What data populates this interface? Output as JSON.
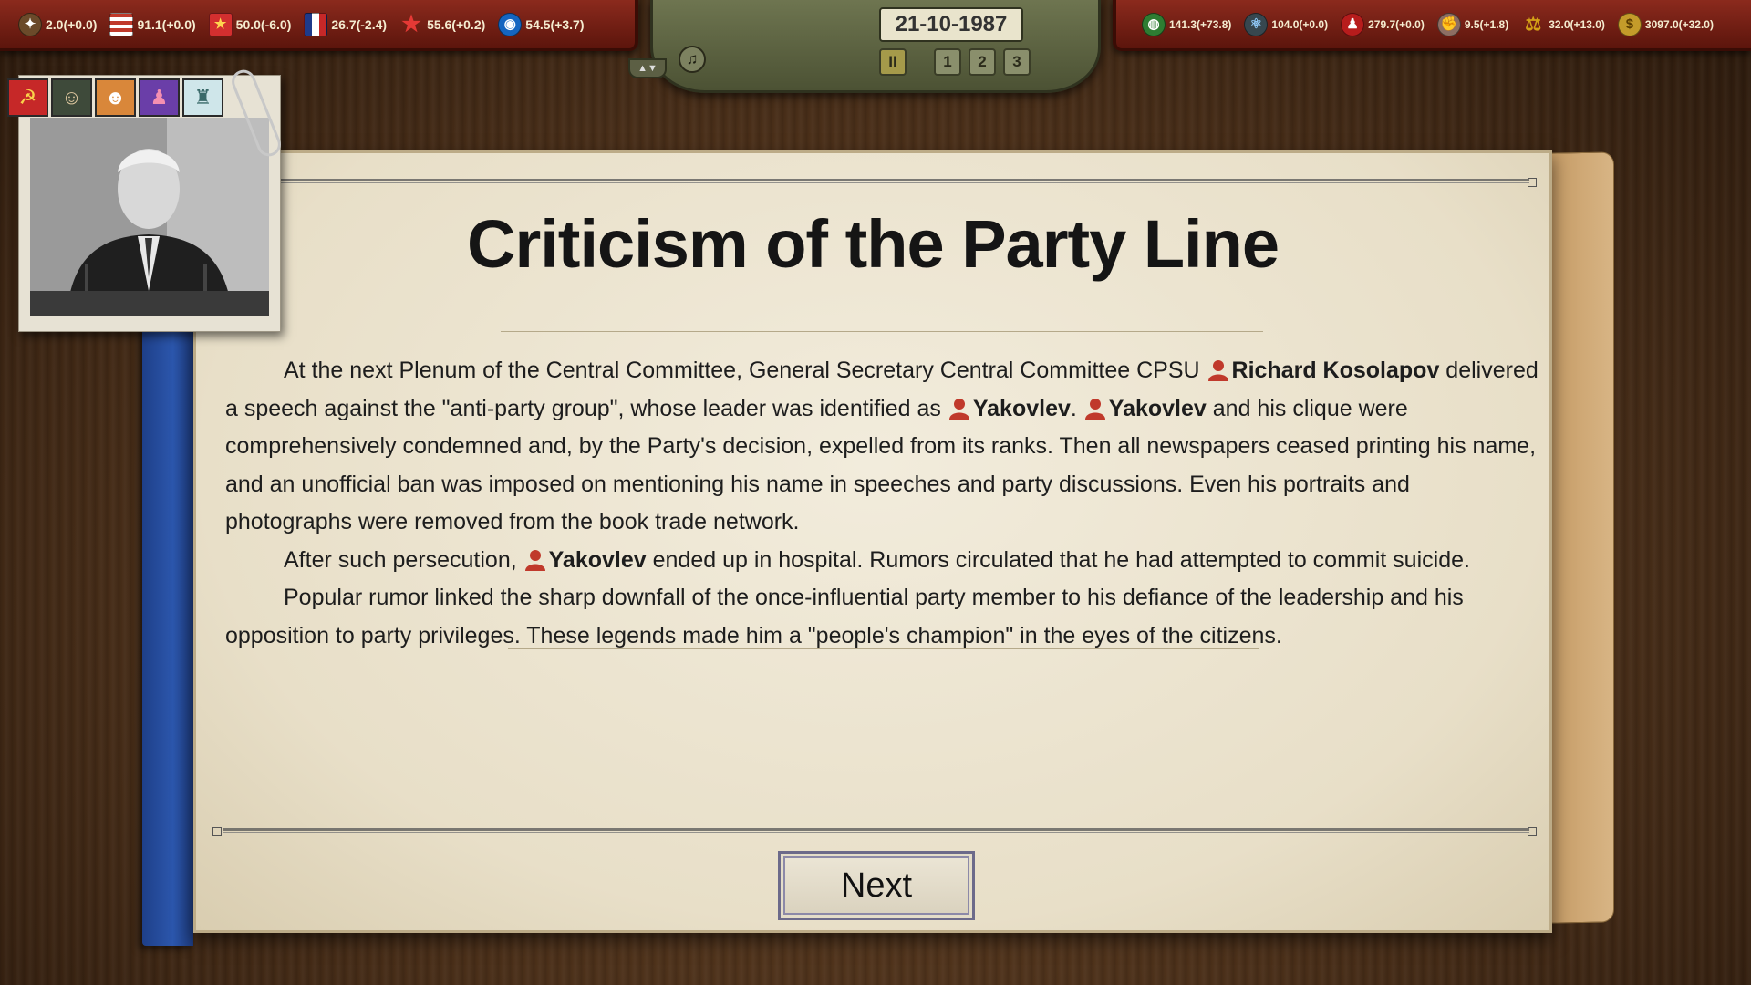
{
  "top_left_stats": [
    {
      "icon": "eagle-icon",
      "value": "2.0(+0.0)"
    },
    {
      "icon": "usa-flag-icon",
      "value": "91.1(+0.0)"
    },
    {
      "icon": "china-flag-icon",
      "value": "50.0(-6.0)"
    },
    {
      "icon": "france-flag-icon",
      "value": "26.7(-2.4)"
    },
    {
      "icon": "red-star-icon",
      "value": "55.6(+0.2)"
    },
    {
      "icon": "globe-badge-icon",
      "value": "54.5(+3.7)"
    }
  ],
  "top_right_stats": [
    {
      "icon": "world-icon",
      "value": "141.3(+73.8)"
    },
    {
      "icon": "atom-icon",
      "value": "104.0(+0.0)"
    },
    {
      "icon": "people-icon",
      "value": "279.7(+0.0)"
    },
    {
      "icon": "fist-icon",
      "value": "9.5(+1.8)"
    },
    {
      "icon": "scales-icon",
      "value": "32.0(+13.0)"
    },
    {
      "icon": "coins-icon",
      "value": "3097.0(+32.0)"
    }
  ],
  "date": "21-10-1987",
  "speed_buttons": [
    "1",
    "2",
    "3"
  ],
  "pause_symbol": "II",
  "music_symbol": "♫",
  "arrow_symbol": "▲▼",
  "trait_icons": [
    {
      "name": "red-stamp-icon",
      "glyph": "☭",
      "bg": "#c62828"
    },
    {
      "name": "bearded-man-icon",
      "glyph": "☺",
      "bg": "#3e4a3a"
    },
    {
      "name": "worker-cap-icon",
      "glyph": "☻",
      "bg": "#d9873a"
    },
    {
      "name": "pink-figure-icon",
      "glyph": "♟",
      "bg": "#6a3ea8"
    },
    {
      "name": "factory-icon",
      "glyph": "♜",
      "bg": "#cfe6ea"
    }
  ],
  "event": {
    "title": "Criticism of the Party Line",
    "p1": {
      "t1": "At the next Plenum of the Central Committee, General Secretary Central Committee CPSU ",
      "n1": "Richard Kosolapov",
      "t2": " delivered a speech against the \"anti-party group\", whose leader was identified as ",
      "n2": "Yakovlev",
      "t3": ". ",
      "n3": "Yakovlev",
      "t4": " and his clique were comprehensively condemned and, by the Party's decision, expelled from its ranks. Then all newspapers ceased printing his name, and an unofficial ban was imposed on mentioning his name in speeches and party discussions. Even his portraits and photographs were removed from the book trade network."
    },
    "p2": {
      "t1": "After such persecution, ",
      "n1": "Yakovlev",
      "t2": " ended up in hospital. Rumors circulated that he had attempted to commit suicide."
    },
    "p3": "Popular rumor linked the sharp downfall of the once-influential party member to his defiance of the leadership and his opposition to party privileges. These legends made him a \"people's champion\" in the eyes of the citizens.",
    "next_label": "Next"
  },
  "colors": {
    "topbar_red": "#8b2a1d",
    "panel_olive": "#6e7550",
    "book_blue": "#2c57ad",
    "paper": "#f2ecdc",
    "person_icon": "#c0392b"
  }
}
